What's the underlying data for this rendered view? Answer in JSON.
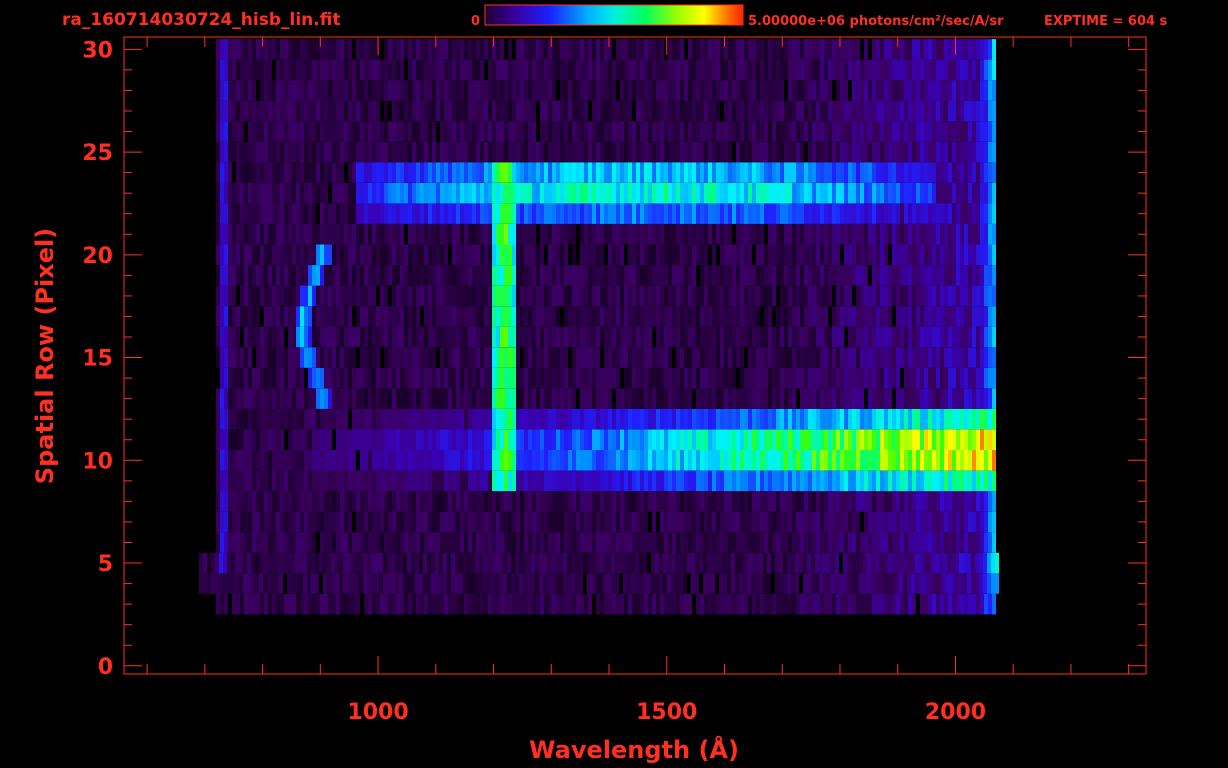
{
  "header": {
    "filename": "ra_160714030724_hisb_lin.fit",
    "colorbar_min_label": "0",
    "colorbar_max_label": "5.00000e+06 photons/cm²/sec/A/sr",
    "exptime_label": "EXPTIME = 604 s"
  },
  "colors": {
    "text": "#ff3020",
    "background": "#000000",
    "colormap": [
      "#000000",
      "#3a0060",
      "#3a00b0",
      "#2020ff",
      "#0090ff",
      "#00f0ff",
      "#00ff80",
      "#40ff00",
      "#c0ff00",
      "#ffff00",
      "#ff8000",
      "#ff2000"
    ]
  },
  "chart_data": {
    "type": "heatmap",
    "title": "",
    "xlabel": "Wavelength (Å)",
    "ylabel": "Spatial Row (Pixel)",
    "xlim": [
      560,
      2330
    ],
    "ylim": [
      -0.4,
      30.6
    ],
    "x_ticks": [
      1000,
      1500,
      2000
    ],
    "x_tick_labels": [
      "1000",
      "1500",
      "2000"
    ],
    "y_ticks": [
      0,
      5,
      10,
      15,
      20,
      25,
      30
    ],
    "y_tick_labels": [
      "0",
      "5",
      "10",
      "15",
      "20",
      "25",
      "30"
    ],
    "colorbar_range": [
      0,
      5000000
    ],
    "colorbar_units": "photons/cm²/sec/A/sr",
    "data_extent_x": [
      720,
      2070
    ],
    "data_rows": [
      3,
      30
    ],
    "features": [
      {
        "type": "horizontal_band",
        "rows": [
          9,
          12
        ],
        "x_range": [
          880,
          2070
        ],
        "peak_fraction": 0.72
      },
      {
        "type": "horizontal_band",
        "rows": [
          22,
          24
        ],
        "x_range": [
          960,
          1960
        ],
        "peak_fraction": 0.5
      },
      {
        "type": "vertical_line",
        "x": 1216,
        "rows": [
          9,
          24
        ],
        "peak_fraction": 0.6
      },
      {
        "type": "arc",
        "x_range": [
          840,
          900
        ],
        "rows": [
          13,
          20
        ],
        "peak_fraction": 0.4
      }
    ]
  }
}
